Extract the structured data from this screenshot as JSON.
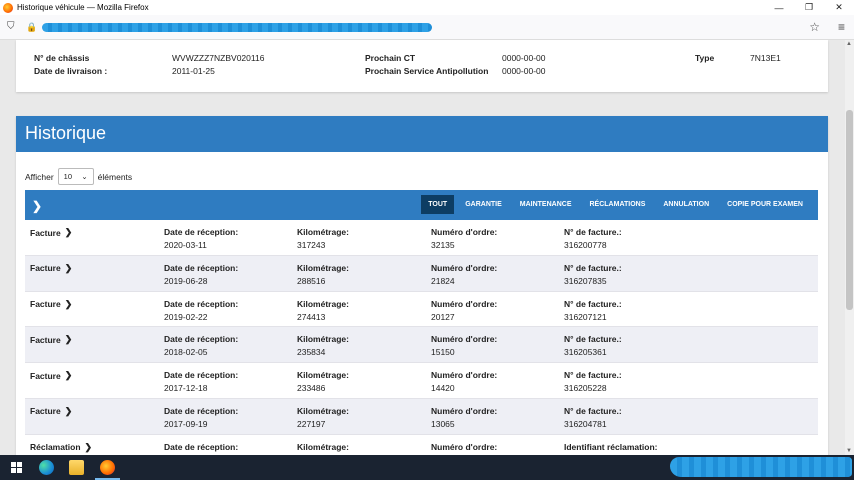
{
  "window": {
    "title": "Historique véhicule — Mozilla Firefox",
    "controls": [
      "—",
      "❐",
      "✕"
    ]
  },
  "navbar": {
    "shield": "⛉",
    "lock": "🔒",
    "star": "☆",
    "menu": "≡"
  },
  "vehicle": {
    "chassis_label": "N° de châssis",
    "chassis_value": "WVWZZZ7NZBV020116",
    "delivery_label": "Date de livraison :",
    "delivery_value": "2011-01-25",
    "ct_label": "Prochain CT",
    "ct_value": "0000-00-00",
    "pollution_label": "Prochain Service Antipollution",
    "pollution_value": "0000-00-00",
    "type_label": "Type",
    "type_value": "7N13E1"
  },
  "history": {
    "title": "Historique",
    "show_label": "Afficher",
    "show_value": "10",
    "show_suffix": "éléments",
    "filters": [
      "TOUT",
      "GARANTIE",
      "MAINTENANCE",
      "RÉCLAMATIONS",
      "ANNULATION",
      "COPIE POUR EXAMEN"
    ],
    "active_filter": "TOUT",
    "rows": [
      {
        "type": "Facture",
        "c1_label": "Date de réception:",
        "c1_value": "2020-03-11",
        "c2_label": "Kilométrage:",
        "c2_value": "317243",
        "c3_label": "Numéro d'ordre:",
        "c3_value": "32135",
        "c4_label": "N° de facture.:",
        "c4_value": "316200778"
      },
      {
        "type": "Facture",
        "c1_label": "Date de réception:",
        "c1_value": "2019-06-28",
        "c2_label": "Kilométrage:",
        "c2_value": "288516",
        "c3_label": "Numéro d'ordre:",
        "c3_value": "21824",
        "c4_label": "N° de facture.:",
        "c4_value": "316207835"
      },
      {
        "type": "Facture",
        "c1_label": "Date de réception:",
        "c1_value": "2019-02-22",
        "c2_label": "Kilométrage:",
        "c2_value": "274413",
        "c3_label": "Numéro d'ordre:",
        "c3_value": "20127",
        "c4_label": "N° de facture.:",
        "c4_value": "316207121"
      },
      {
        "type": "Facture",
        "c1_label": "Date de réception:",
        "c1_value": "2018-02-05",
        "c2_label": "Kilométrage:",
        "c2_value": "235834",
        "c3_label": "Numéro d'ordre:",
        "c3_value": "15150",
        "c4_label": "N° de facture.:",
        "c4_value": "316205361"
      },
      {
        "type": "Facture",
        "c1_label": "Date de réception:",
        "c1_value": "2017-12-18",
        "c2_label": "Kilométrage:",
        "c2_value": "233486",
        "c3_label": "Numéro d'ordre:",
        "c3_value": "14420",
        "c4_label": "N° de facture.:",
        "c4_value": "316205228"
      },
      {
        "type": "Facture",
        "c1_label": "Date de réception:",
        "c1_value": "2017-09-19",
        "c2_label": "Kilométrage:",
        "c2_value": "227197",
        "c3_label": "Numéro d'ordre:",
        "c3_value": "13065",
        "c4_label": "N° de facture.:",
        "c4_value": "316204781"
      },
      {
        "type": "Réclamation",
        "c1_label": "Date de réception:",
        "c1_value": "",
        "c2_label": "Kilométrage:",
        "c2_value": "",
        "c3_label": "Numéro d'ordre:",
        "c3_value": "",
        "c4_label": "Identifiant réclamation:",
        "c4_value": ""
      }
    ]
  }
}
